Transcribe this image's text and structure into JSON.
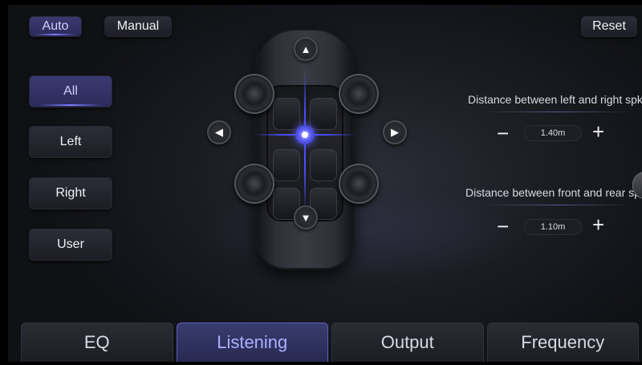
{
  "header": {
    "mode_auto_label": "Auto",
    "mode_manual_label": "Manual",
    "reset_label": "Reset"
  },
  "sidebar": {
    "items": [
      {
        "label": "All",
        "selected": true
      },
      {
        "label": "Left",
        "selected": false
      },
      {
        "label": "Right",
        "selected": false
      },
      {
        "label": "User",
        "selected": false
      }
    ]
  },
  "car_diagram": {
    "arrow_icons": [
      "arrow-up-icon",
      "arrow-down-icon",
      "arrow-left-icon",
      "arrow-right-icon"
    ],
    "speakers": [
      "front-left-speaker",
      "front-right-speaker",
      "rear-left-speaker",
      "rear-right-speaker"
    ]
  },
  "distance": {
    "left_right": {
      "label": "Distance between left and right spk",
      "value": "1.40m",
      "minus": "−",
      "plus": "+"
    },
    "front_rear": {
      "label": "Distance between front and rear spk",
      "value": "1.10m",
      "minus": "−",
      "plus": "+"
    }
  },
  "tabs": [
    {
      "label": "EQ",
      "active": false
    },
    {
      "label": "Listening",
      "active": true
    },
    {
      "label": "Output",
      "active": false
    },
    {
      "label": "Frequency",
      "active": false
    }
  ],
  "colors": {
    "accent": "#5a5cf5",
    "active_button": "#3b3a72",
    "background": "#1a1c22"
  }
}
